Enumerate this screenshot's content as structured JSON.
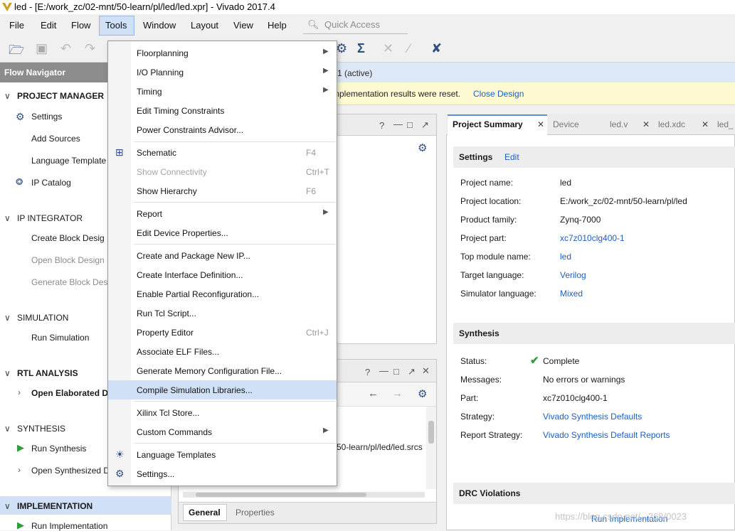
{
  "title_bar": {
    "text": "led - [E:/work_zc/02-mnt/50-learn/pl/led/led.xpr] - Vivado 2017.4"
  },
  "menu_bar": {
    "items": [
      "File",
      "Edit",
      "Flow",
      "Tools",
      "Window",
      "Layout",
      "View",
      "Help"
    ],
    "quick_access_placeholder": "Quick Access"
  },
  "flow_navigator": {
    "header": "Flow Navigator",
    "project_manager": {
      "title": "PROJECT MANAGER",
      "settings": "Settings",
      "add_sources": "Add Sources",
      "language_templates": "Language Template",
      "ip_catalog": "IP Catalog"
    },
    "ip_integrator": {
      "title": "IP INTEGRATOR",
      "create": "Create Block Desig",
      "open": "Open Block Design",
      "generate": "Generate Block Des"
    },
    "simulation": {
      "title": "SIMULATION",
      "run": "Run Simulation"
    },
    "rtl_analysis": {
      "title": "RTL ANALYSIS",
      "open": "Open Elaborated De"
    },
    "synthesis": {
      "title": "SYNTHESIS",
      "run": "Run Synthesis",
      "open": "Open Synthesized D"
    },
    "implementation": {
      "title": "IMPLEMENTATION",
      "run": "Run Implementation"
    }
  },
  "main": {
    "active_bar": "1  (active)",
    "warning_text": "mplementation results were reset.",
    "warning_link": "Close Design",
    "panel2_path": "50-learn/pl/led/led.srcs",
    "bottom_tabs": [
      "General",
      "Properties"
    ]
  },
  "summary": {
    "tabs": [
      "Project Summary",
      "Device",
      "led.v",
      "led.xdc",
      "led_"
    ],
    "settings": {
      "header": "Settings",
      "edit_link": "Edit",
      "rows": [
        {
          "label": "Project name:",
          "value": "led"
        },
        {
          "label": "Project location:",
          "value": "E:/work_zc/02-mnt/50-learn/pl/led"
        },
        {
          "label": "Product family:",
          "value": "Zynq-7000"
        },
        {
          "label": "Project part:",
          "value": "xc7z010clg400-1"
        },
        {
          "label": "Top module name:",
          "value": "led"
        },
        {
          "label": "Target language:",
          "value": "Verilog"
        },
        {
          "label": "Simulator language:",
          "value": "Mixed"
        }
      ]
    },
    "synthesis": {
      "header": "Synthesis",
      "rows": [
        {
          "label": "Status:",
          "value": "Complete"
        },
        {
          "label": "Messages:",
          "value": "No errors or warnings"
        },
        {
          "label": "Part:",
          "value": "xc7z010clg400-1"
        },
        {
          "label": "Strategy:",
          "value": "Vivado Synthesis Defaults"
        },
        {
          "label": "Report Strategy:",
          "value": "Vivado Synthesis Default Reports"
        }
      ]
    },
    "drc": {
      "header": "DRC Violations",
      "link": "Run Implementation"
    }
  },
  "tools_menu": {
    "items": [
      {
        "label": "Floorplanning"
      },
      {
        "label": "I/O Planning"
      },
      {
        "label": "Timing"
      },
      {
        "label": "Edit Timing Constraints"
      },
      {
        "label": "Power Constraints Advisor..."
      },
      {
        "label": "Schematic",
        "shortcut": "F4"
      },
      {
        "label": "Show Connectivity",
        "shortcut": "Ctrl+T"
      },
      {
        "label": "Show Hierarchy",
        "shortcut": "F6"
      },
      {
        "label": "Report"
      },
      {
        "label": "Edit Device Properties..."
      },
      {
        "label": "Create and Package New IP..."
      },
      {
        "label": "Create Interface Definition..."
      },
      {
        "label": "Enable Partial Reconfiguration..."
      },
      {
        "label": "Run Tcl Script..."
      },
      {
        "label": "Property Editor",
        "shortcut": "Ctrl+J"
      },
      {
        "label": "Associate ELF Files..."
      },
      {
        "label": "Generate Memory Configuration File..."
      },
      {
        "label": "Compile Simulation Libraries..."
      },
      {
        "label": "Xilinx Tcl Store..."
      },
      {
        "label": "Custom Commands"
      },
      {
        "label": "Language Templates"
      },
      {
        "label": "Settings..."
      }
    ]
  },
  "watermark": "https://blog.csdn.net/...268/0023"
}
